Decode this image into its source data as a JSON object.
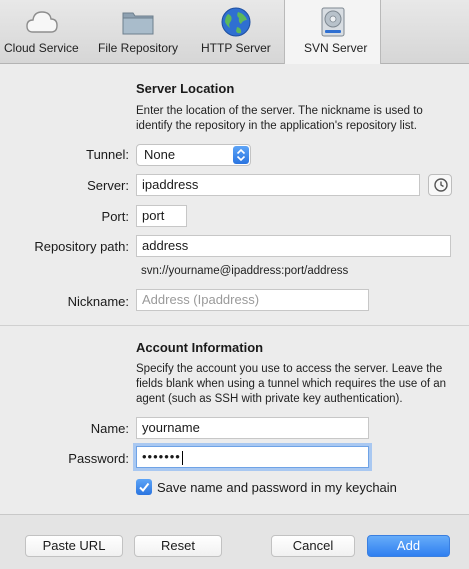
{
  "toolbar": {
    "items": [
      {
        "label": "Cloud Service",
        "icon": "cloud-icon"
      },
      {
        "label": "File Repository",
        "icon": "folder-icon"
      },
      {
        "label": "HTTP Server",
        "icon": "globe-icon"
      },
      {
        "label": "SVN Server",
        "icon": "disk-icon",
        "selected": true
      }
    ]
  },
  "server_location": {
    "title": "Server Location",
    "description": "Enter the location of the server. The nickname is used to identify the repository in the application's repository list.",
    "tunnel": {
      "label": "Tunnel:",
      "value": "None"
    },
    "server": {
      "label": "Server:",
      "value": "ipaddress"
    },
    "port": {
      "label": "Port:",
      "value": "port"
    },
    "repository_path": {
      "label": "Repository path:",
      "value": "address"
    },
    "url_preview": "svn://yourname@ipaddress:port/address",
    "nickname": {
      "label": "Nickname:",
      "placeholder": "Address (Ipaddress)",
      "value": ""
    }
  },
  "account": {
    "title": "Account Information",
    "description": "Specify the account you use to access the server. Leave the fields blank when using a tunnel which requires the use of an agent (such as SSH with private key authentication).",
    "name": {
      "label": "Name:",
      "value": "yourname"
    },
    "password": {
      "label": "Password:",
      "masked": "•••••••"
    },
    "keychain": {
      "label": "Save name and password in my keychain",
      "checked": true
    }
  },
  "buttons": {
    "paste_url": "Paste URL",
    "reset": "Reset",
    "cancel": "Cancel",
    "add": "Add"
  },
  "colors": {
    "accent": "#2f7ff0",
    "focus_ring": "#a9c8f1"
  }
}
